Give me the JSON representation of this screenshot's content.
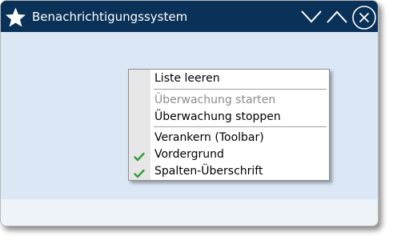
{
  "window": {
    "title": "Benachrichtigungssystem",
    "title_icon": "star-icon",
    "controls": {
      "minimize_icon": "chevron-down-icon",
      "maximize_icon": "chevron-up-icon",
      "close_icon": "close-icon"
    }
  },
  "colors": {
    "titlebar": "#0a3157",
    "client": "#dbe7f5",
    "check": "#2e9e3a"
  },
  "context_menu": {
    "items": [
      {
        "label": "Liste leeren",
        "enabled": true,
        "checked": false
      },
      {
        "label": "Überwachung starten",
        "enabled": false,
        "checked": false
      },
      {
        "label": "Überwachung stoppen",
        "enabled": true,
        "checked": false
      },
      {
        "label": "Verankern (Toolbar)",
        "enabled": true,
        "checked": false
      },
      {
        "label": "Vordergrund",
        "enabled": true,
        "checked": true
      },
      {
        "label": "Spalten-Überschrift",
        "enabled": true,
        "checked": true
      }
    ]
  }
}
